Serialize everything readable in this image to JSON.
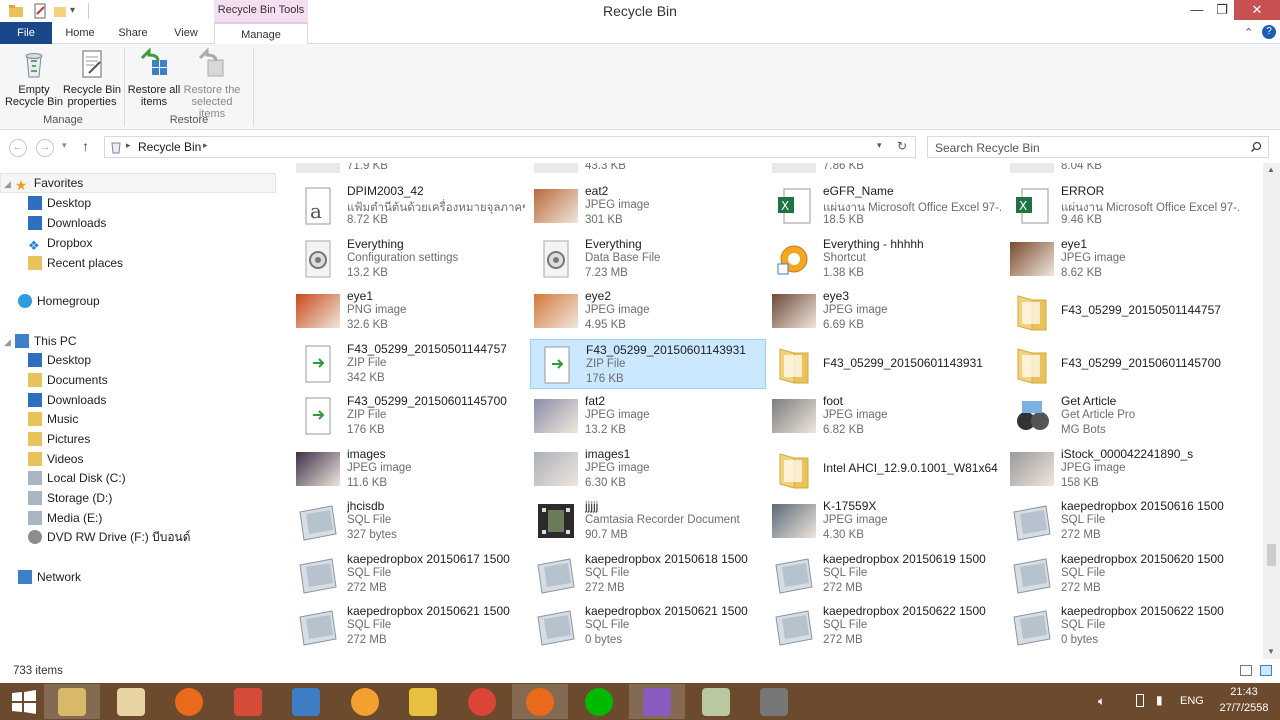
{
  "window": {
    "title": "Recycle Bin",
    "context_tab_group": "Recycle Bin Tools",
    "controls": {
      "minimize": "—",
      "maximize": "❐",
      "close": "✕"
    }
  },
  "tabs": [
    "File",
    "Home",
    "Share",
    "View",
    "Manage"
  ],
  "ribbon": {
    "empty_label": "Empty Recycle Bin",
    "properties_label": "Recycle Bin properties",
    "restore_all_label": "Restore all items",
    "restore_selected_label": "Restore the selected items",
    "manage_group": "Manage",
    "restore_group": "Restore"
  },
  "address": {
    "path": "Recycle Bin",
    "search_placeholder": "Search Recycle Bin"
  },
  "nav": {
    "favorites": "Favorites",
    "fav_items": [
      "Desktop",
      "Downloads",
      "Dropbox",
      "Recent places"
    ],
    "homegroup": "Homegroup",
    "thispc": "This PC",
    "pc_items": [
      "Desktop",
      "Documents",
      "Downloads",
      "Music",
      "Pictures",
      "Videos",
      "Local Disk (C:)",
      "Storage (D:)",
      "Media (E:)",
      "DVD RW Drive (F:) บีบอนด์"
    ],
    "network": "Network"
  },
  "top_partial": [
    "71.9 KB",
    "43.3 KB",
    "7.86 KB",
    "8.04 KB"
  ],
  "files": [
    {
      "name": "DPIM2003_42",
      "type": "แฟ้มตำนีต้นด้วยเครื่องหมายจุลภาคของ ...",
      "size": "8.72 KB",
      "icon": "text-file-icon"
    },
    {
      "name": "eat2",
      "type": "JPEG image",
      "size": "301 KB",
      "icon": "photo-thumbnail"
    },
    {
      "name": "eGFR_Name",
      "type": "แผ่นงาน Microsoft Office Excel 97-...",
      "size": "18.5 KB",
      "icon": "excel-icon"
    },
    {
      "name": "ERROR",
      "type": "แผ่นงาน Microsoft Office Excel 97-...",
      "size": "9.46 KB",
      "icon": "excel-icon"
    },
    {
      "name": "Everything",
      "type": "Configuration settings",
      "size": "13.2 KB",
      "icon": "settings-file-icon"
    },
    {
      "name": "Everything",
      "type": "Data Base File",
      "size": "7.23 MB",
      "icon": "settings-file-icon"
    },
    {
      "name": "Everything - hhhhh",
      "type": "Shortcut",
      "size": "1.38 KB",
      "icon": "shortcut-icon"
    },
    {
      "name": "eye1",
      "type": "JPEG image",
      "size": "8.62 KB",
      "icon": "photo-thumbnail"
    },
    {
      "name": "eye1",
      "type": "PNG image",
      "size": "32.6 KB",
      "icon": "photo-thumbnail"
    },
    {
      "name": "eye2",
      "type": "JPEG image",
      "size": "4.95 KB",
      "icon": "photo-thumbnail"
    },
    {
      "name": "eye3",
      "type": "JPEG image",
      "size": "6.69 KB",
      "icon": "photo-thumbnail"
    },
    {
      "name": "F43_05299_20150501144757",
      "type": "",
      "size": "",
      "icon": "folder-icon"
    },
    {
      "name": "F43_05299_20150501144757",
      "type": "ZIP File",
      "size": "342 KB",
      "icon": "zip-icon"
    },
    {
      "name": "F43_05299_20150601143931",
      "type": "ZIP File",
      "size": "176 KB",
      "icon": "zip-icon",
      "selected": true
    },
    {
      "name": "F43_05299_20150601143931",
      "type": "",
      "size": "",
      "icon": "folder-icon"
    },
    {
      "name": "F43_05299_20150601145700",
      "type": "",
      "size": "",
      "icon": "folder-icon"
    },
    {
      "name": "F43_05299_20150601145700",
      "type": "ZIP File",
      "size": "176 KB",
      "icon": "zip-icon"
    },
    {
      "name": "fat2",
      "type": "JPEG image",
      "size": "13.2 KB",
      "icon": "photo-thumbnail"
    },
    {
      "name": "foot",
      "type": "JPEG image",
      "size": "6.82 KB",
      "icon": "photo-thumbnail"
    },
    {
      "name": "Get Article",
      "type": "Get Article Pro",
      "size": "MG Bots",
      "icon": "app-icon"
    },
    {
      "name": "images",
      "type": "JPEG image",
      "size": "11.6 KB",
      "icon": "photo-thumbnail"
    },
    {
      "name": "images1",
      "type": "JPEG image",
      "size": "6.30 KB",
      "icon": "photo-thumbnail"
    },
    {
      "name": "Intel AHCI_12.9.0.1001_W81x64",
      "type": "",
      "size": "",
      "icon": "folder-icon"
    },
    {
      "name": "iStock_000042241890_s",
      "type": "JPEG image",
      "size": "158 KB",
      "icon": "photo-thumbnail"
    },
    {
      "name": "jhcisdb",
      "type": "SQL File",
      "size": "327 bytes",
      "icon": "sql-file-icon"
    },
    {
      "name": "jjjjj",
      "type": "Camtasia Recorder Document",
      "size": "90.7 MB",
      "icon": "video-file-icon"
    },
    {
      "name": "K-17559X",
      "type": "JPEG image",
      "size": "4.30 KB",
      "icon": "photo-thumbnail"
    },
    {
      "name": "kaepedropbox 20150616 1500",
      "type": "SQL File",
      "size": "272 MB",
      "icon": "sql-file-icon"
    },
    {
      "name": "kaepedropbox 20150617 1500",
      "type": "SQL File",
      "size": "272 MB",
      "icon": "sql-file-icon"
    },
    {
      "name": "kaepedropbox 20150618 1500",
      "type": "SQL File",
      "size": "272 MB",
      "icon": "sql-file-icon"
    },
    {
      "name": "kaepedropbox 20150619 1500",
      "type": "SQL File",
      "size": "272 MB",
      "icon": "sql-file-icon"
    },
    {
      "name": "kaepedropbox 20150620 1500",
      "type": "SQL File",
      "size": "272 MB",
      "icon": "sql-file-icon"
    },
    {
      "name": "kaepedropbox 20150621 1500",
      "type": "SQL File",
      "size": "272 MB",
      "icon": "sql-file-icon"
    },
    {
      "name": "kaepedropbox 20150621 1500",
      "type": "SQL File",
      "size": "0 bytes",
      "icon": "sql-file-icon"
    },
    {
      "name": "kaepedropbox 20150622 1500",
      "type": "SQL File",
      "size": "272 MB",
      "icon": "sql-file-icon"
    },
    {
      "name": "kaepedropbox 20150622 1500",
      "type": "SQL File",
      "size": "0 bytes",
      "icon": "sql-file-icon"
    }
  ],
  "status": {
    "item_count": "733 items"
  },
  "taskbar": {
    "apps": [
      "start-icon",
      "file-explorer-icon",
      "search-tool-icon",
      "firefox-icon",
      "paint-icon",
      "app-icon",
      "orange-app-icon",
      "sketch-app-icon",
      "chrome-icon",
      "firefox-icon",
      "line-icon",
      "editor-icon",
      "document-icon",
      "device-icon"
    ],
    "lang": "ENG",
    "time": "21:43",
    "date": "27/7/2558"
  },
  "colors": {
    "accent": "#19478a",
    "selection": "#cce8ff",
    "taskbar": "#6b4a2e",
    "context_tab": "#f3dff1"
  }
}
